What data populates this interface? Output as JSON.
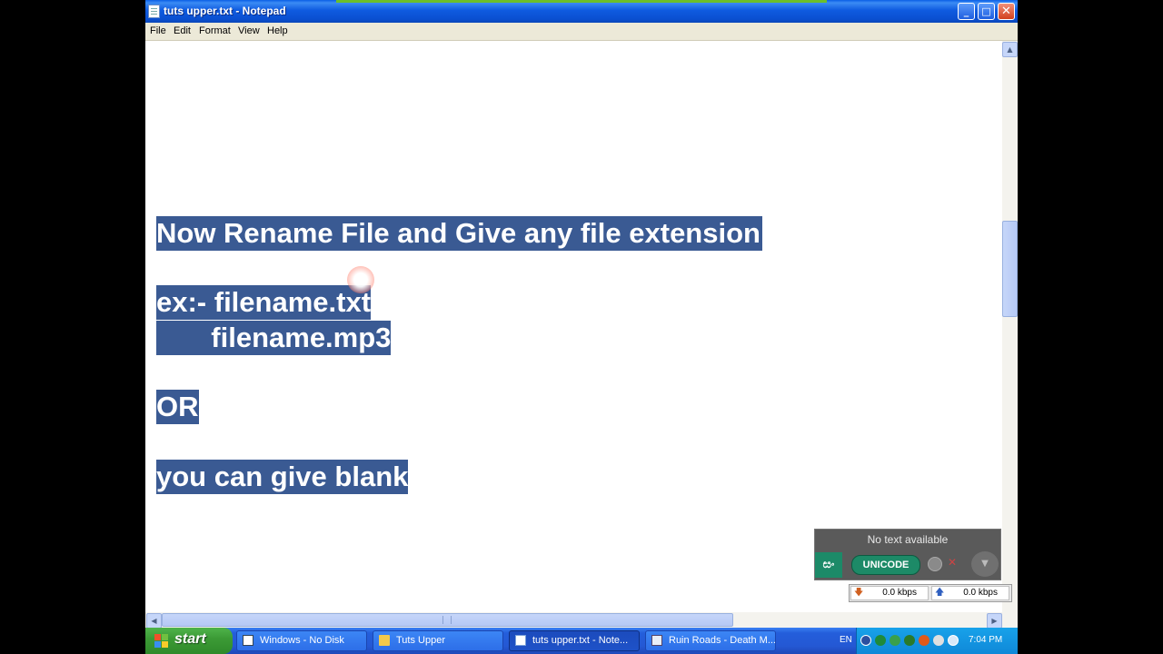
{
  "window": {
    "title": "tuts upper.txt - Notepad",
    "buttons": {
      "minimize": "_",
      "maximize": "□",
      "close": "✕"
    }
  },
  "menu": [
    "File",
    "Edit",
    "Format",
    "View",
    "Help"
  ],
  "editor": {
    "line1": "Now Rename File and Give any file extension",
    "line2": "ex:- filename.txt",
    "line3": "       filename.mp3",
    "line4": "OR",
    "line5": "you can give blank"
  },
  "scrollbars": {
    "up": "▲",
    "left": "◀",
    "right": "▶"
  },
  "widget": {
    "status": "No text available",
    "logo": "සං",
    "mode": "UNICODE",
    "close": "✕",
    "dropdown": "▼"
  },
  "netmeter": {
    "down": "0.0 kbps",
    "up": "0.0 kbps",
    "down_arrow": "🡇",
    "up_arrow": "🡅"
  },
  "taskbar": {
    "start": "start",
    "tasks": [
      {
        "label": "Windows - No Disk"
      },
      {
        "label": "Tuts Upper"
      },
      {
        "label": "tuts upper.txt - Note..."
      },
      {
        "label": "Ruin Roads - Death M..."
      }
    ],
    "language": "EN",
    "clock": "7:04 PM"
  },
  "colors": {
    "selection": "#3a5a93",
    "titlebar": "#0a4fd0",
    "taskbar": "#245edb",
    "start": "#3c9b36",
    "widget_green": "#1d8a67"
  }
}
